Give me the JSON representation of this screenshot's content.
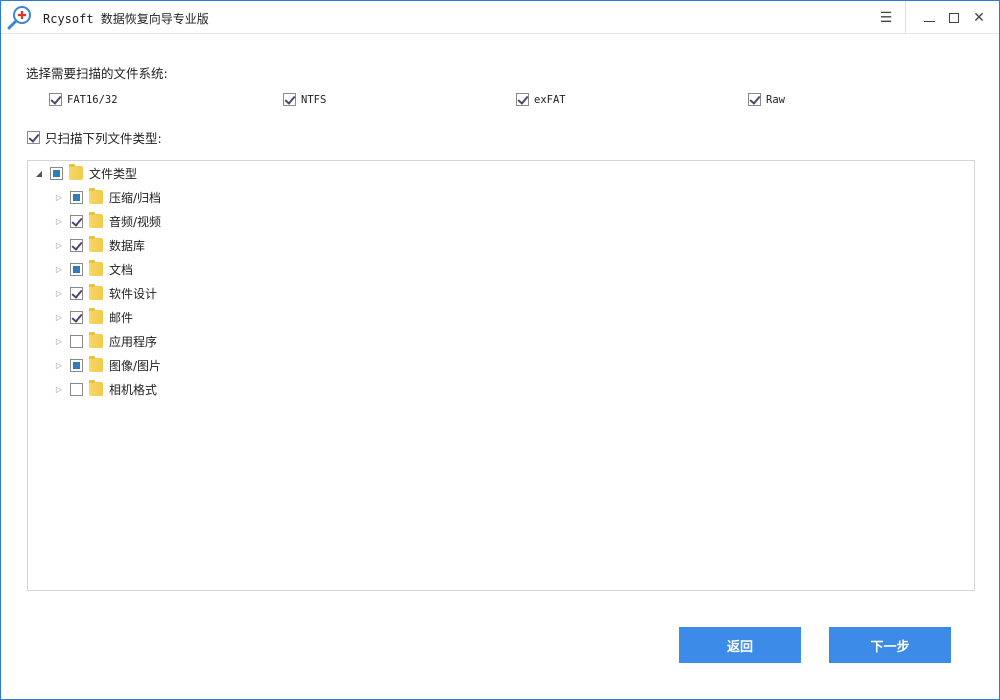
{
  "window": {
    "title": "Rcysoft 数据恢复向导专业版",
    "menu_icon": "hamburger-icon",
    "minimize_icon": "minimize-icon",
    "maximize_icon": "maximize-icon",
    "close_icon": "close-icon"
  },
  "filesystems": {
    "label": "选择需要扫描的文件系统:",
    "items": [
      {
        "label": "FAT16/32",
        "checked": true
      },
      {
        "label": "NTFS",
        "checked": true
      },
      {
        "label": "exFAT",
        "checked": true
      },
      {
        "label": "Raw",
        "checked": true
      }
    ]
  },
  "filetypes": {
    "label": "只扫描下列文件类型:",
    "checked": true,
    "root": {
      "label": "文件类型",
      "state": "partial",
      "expanded": true
    },
    "items": [
      {
        "label": "压缩/归档",
        "state": "partial"
      },
      {
        "label": "音频/视频",
        "state": "checked"
      },
      {
        "label": "数据库",
        "state": "checked"
      },
      {
        "label": "文档",
        "state": "partial"
      },
      {
        "label": "软件设计",
        "state": "checked"
      },
      {
        "label": "邮件",
        "state": "checked"
      },
      {
        "label": "应用程序",
        "state": "unchecked"
      },
      {
        "label": "图像/图片",
        "state": "partial"
      },
      {
        "label": "相机格式",
        "state": "unchecked"
      }
    ]
  },
  "buttons": {
    "back": "返回",
    "next": "下一步"
  },
  "colors": {
    "accent": "#3d8be8",
    "border": "#2b7bd6"
  }
}
